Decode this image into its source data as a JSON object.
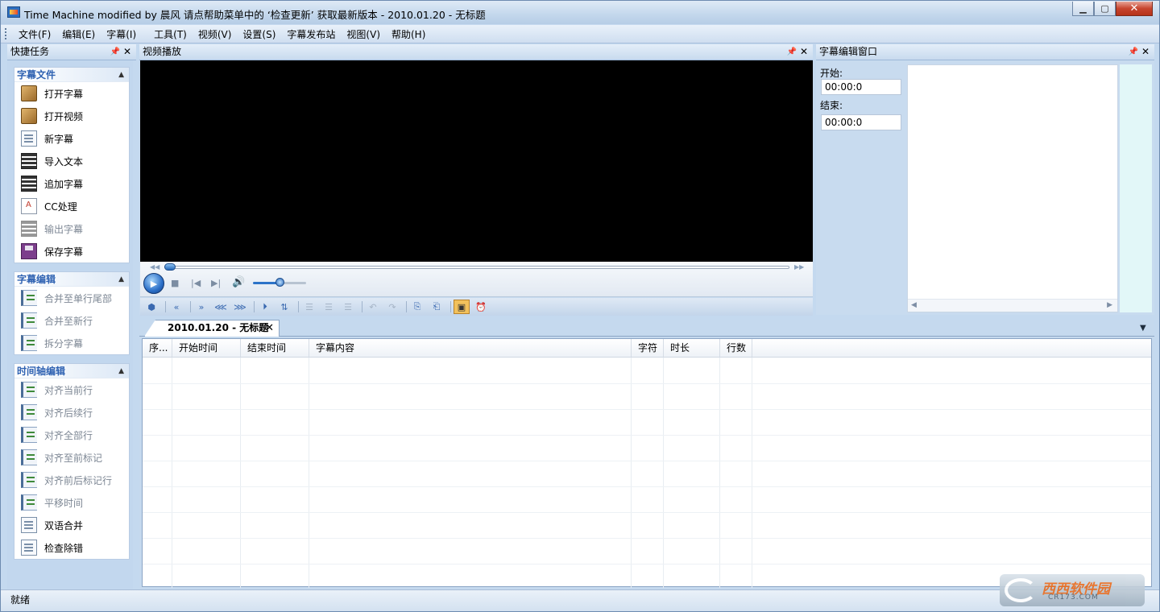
{
  "window": {
    "title": "Time Machine modified by 晨风 请点帮助菜单中的 ‘检查更新’ 获取最新版本 - 2010.01.20 - 无标题"
  },
  "menubar": {
    "items": [
      "文件(F)",
      "编辑(E)",
      "字幕(I)",
      "工具(T)",
      "视频(V)",
      "设置(S)",
      "字幕发布站",
      "视图(V)",
      "帮助(H)"
    ]
  },
  "left_pane": {
    "title": "快捷任务",
    "groups": [
      {
        "header": "字幕文件",
        "items": [
          {
            "label": "打开字幕",
            "icon": "box-icon",
            "enabled": true
          },
          {
            "label": "打开视频",
            "icon": "box-icon",
            "enabled": true
          },
          {
            "label": "新字幕",
            "icon": "document-icon",
            "enabled": true
          },
          {
            "label": "导入文本",
            "icon": "film-icon",
            "enabled": true
          },
          {
            "label": "追加字幕",
            "icon": "film-icon",
            "enabled": true
          },
          {
            "label": "CC处理",
            "icon": "cc-icon",
            "enabled": true
          },
          {
            "label": "输出字幕",
            "icon": "export-icon",
            "enabled": false
          },
          {
            "label": "保存字幕",
            "icon": "save-icon",
            "enabled": true
          }
        ]
      },
      {
        "header": "字幕编辑",
        "items": [
          {
            "label": "合并至单行尾部",
            "icon": "merge-icon",
            "enabled": false
          },
          {
            "label": "合并至新行",
            "icon": "merge-icon",
            "enabled": false
          },
          {
            "label": "拆分字幕",
            "icon": "split-icon",
            "enabled": false
          }
        ]
      },
      {
        "header": "时间轴编辑",
        "items": [
          {
            "label": "对齐当前行",
            "icon": "align-icon",
            "enabled": false
          },
          {
            "label": "对齐后续行",
            "icon": "align-icon",
            "enabled": false
          },
          {
            "label": "对齐全部行",
            "icon": "align-icon",
            "enabled": false
          },
          {
            "label": "对齐至前标记",
            "icon": "align-icon",
            "enabled": false
          },
          {
            "label": "对齐前后标记行",
            "icon": "align-icon",
            "enabled": false
          },
          {
            "label": "平移时间",
            "icon": "shift-icon",
            "enabled": false
          },
          {
            "label": "双语合并",
            "icon": "bilingual-icon",
            "enabled": true
          },
          {
            "label": "检查除错",
            "icon": "check-icon",
            "enabled": true
          }
        ]
      }
    ]
  },
  "video_pane": {
    "title": "视频播放"
  },
  "edit_pane": {
    "title": "字幕编辑窗口",
    "start_label": "开始:",
    "start_value": "00:00:0",
    "end_label": "结束:",
    "end_value": "00:00:0"
  },
  "document": {
    "tab_label": "2010.01.20 - 无标题",
    "columns": [
      "序...",
      "开始时间",
      "结束时间",
      "字幕内容",
      "字符",
      "时长",
      "行数"
    ]
  },
  "statusbar": {
    "text": "就绪"
  },
  "watermark": {
    "text": "西西软件园",
    "sub": "CR173.COM"
  },
  "colors": {
    "group_header": "#2f62b2",
    "video_bg": "#000000",
    "panel_bg": "#c8dbef"
  }
}
